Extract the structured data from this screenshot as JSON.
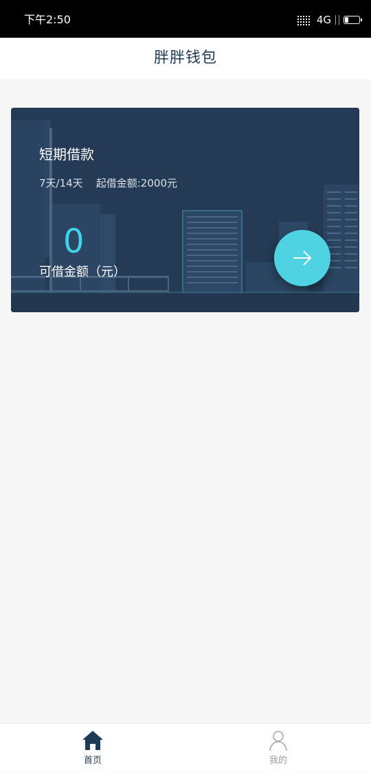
{
  "status_bar": {
    "time": "下午2:50",
    "network": "4G"
  },
  "header": {
    "title": "胖胖钱包"
  },
  "loan_card": {
    "title": "短期借款",
    "terms": "7天/14天    起借金额:2000元",
    "amount_value": "0",
    "amount_label": "可借金额（元）",
    "action_icon": "arrow-right-icon",
    "colors": {
      "card_bg": "#243a55",
      "accent": "#4fd2e2",
      "amount": "#3fd3ea"
    }
  },
  "tab_bar": {
    "tabs": [
      {
        "label": "首页",
        "icon": "home-icon",
        "active": true
      },
      {
        "label": "我的",
        "icon": "user-icon",
        "active": false
      }
    ],
    "colors": {
      "active": "#1f3a55",
      "inactive": "#9a9a9a"
    }
  }
}
